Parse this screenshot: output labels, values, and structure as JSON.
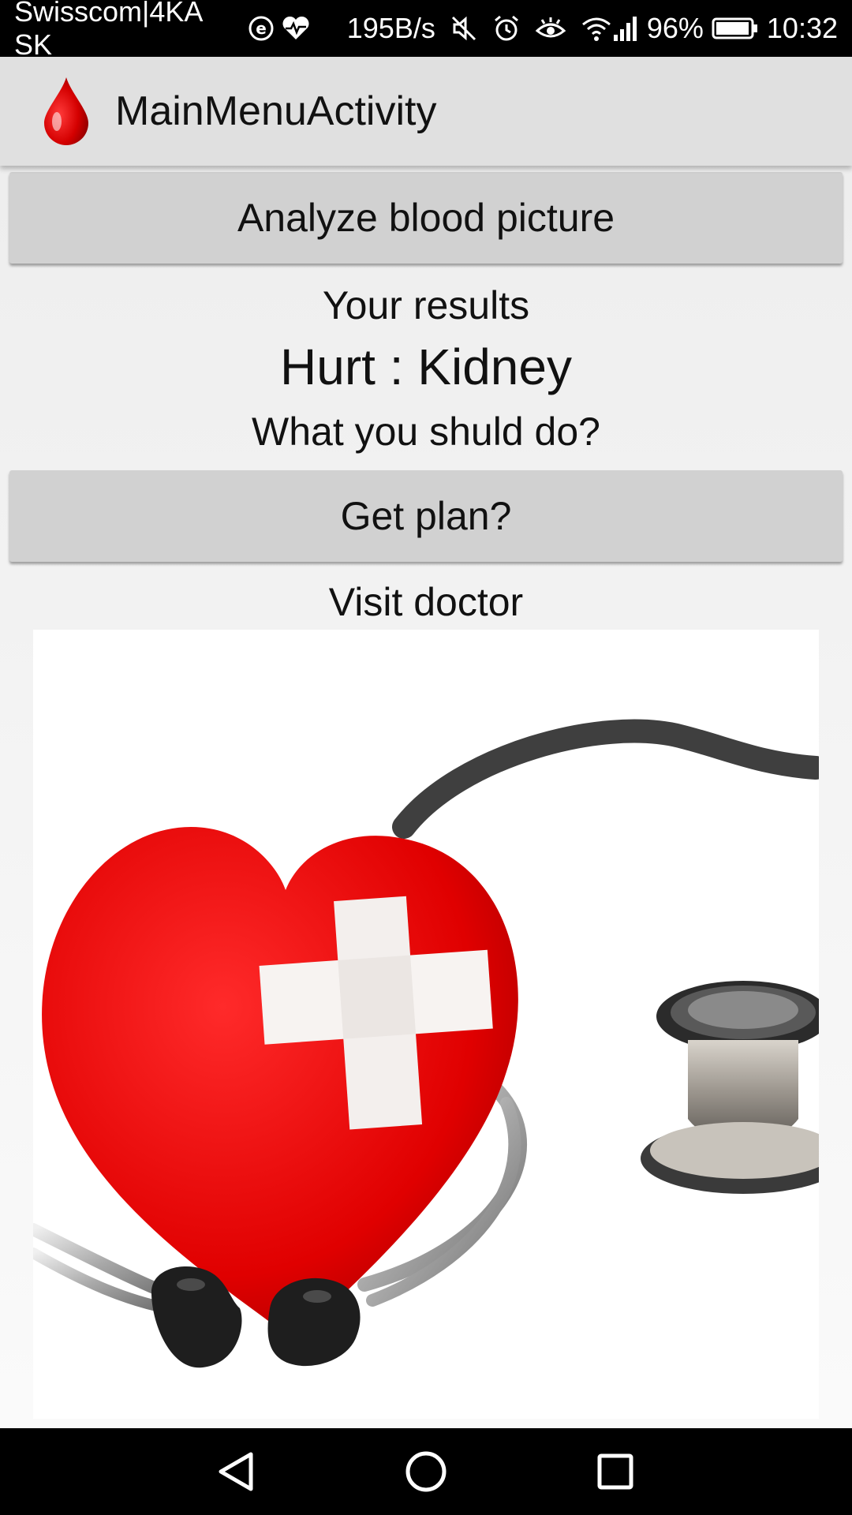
{
  "status_bar": {
    "carrier": "Swisscom|4KA SK",
    "speed": "195B/s",
    "battery": "96%",
    "time": "10:32",
    "icons": [
      "e-icon",
      "health-icon",
      "mute-icon",
      "alarm-icon",
      "eye-icon",
      "wifi-icon",
      "signal-icon",
      "battery-icon"
    ]
  },
  "app_bar": {
    "title": "MainMenuActivity",
    "logo": "blood-drop-icon"
  },
  "main": {
    "analyze_button": "Analyze blood picture",
    "results_heading": "Your results",
    "result_value": "Hurt : Kidney",
    "question": "What you shuld do?",
    "plan_button": "Get plan?",
    "advice": "Visit doctor",
    "image": "heart-stethoscope-image"
  },
  "nav_bar": {
    "icons": [
      "back-icon",
      "home-icon",
      "recents-icon"
    ]
  },
  "colors": {
    "accent_red": "#e00000",
    "button_gray": "#d1d1d1",
    "app_bar": "#e0e0e0"
  }
}
